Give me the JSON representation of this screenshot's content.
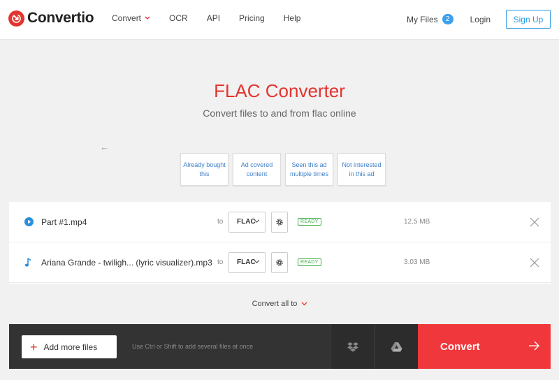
{
  "header": {
    "brand": "Convertio",
    "nav": [
      "Convert",
      "OCR",
      "API",
      "Pricing",
      "Help"
    ],
    "my_files": "My Files",
    "my_files_count": "2",
    "login": "Login",
    "signup": "Sign Up"
  },
  "hero": {
    "title": "FLAC Converter",
    "subtitle": "Convert files to and from flac online"
  },
  "ad_feedback": [
    "Already bought this",
    "Ad covered content",
    "Seen this ad multiple times",
    "Not interested in this ad"
  ],
  "files": [
    {
      "name": "Part #1.mp4",
      "icon": "video-play-icon",
      "to": "to",
      "format": "FLAC",
      "status": "READY",
      "size": "12.5 MB"
    },
    {
      "name": "Ariana Grande - twiligh... (lyric visualizer).mp3",
      "icon": "music-note-icon",
      "to": "to",
      "format": "FLAC",
      "status": "READY",
      "size": "3.03 MB"
    }
  ],
  "convert_all": "Convert all to",
  "bottom_bar": {
    "add_more": "Add more files",
    "hint": "Use Ctrl or Shift to add several files at once",
    "convert": "Convert"
  },
  "colors": {
    "brand_red": "#e3342f",
    "accent_blue": "#2a9ae3",
    "ready_green": "#3fae49",
    "bar_dark": "#333333"
  }
}
